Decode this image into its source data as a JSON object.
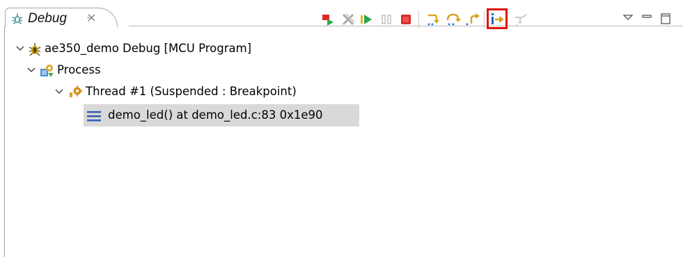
{
  "view": {
    "tab_title": "Debug",
    "tab_icon": "debug-bug-icon",
    "close_icon": "close-icon"
  },
  "toolbar": {
    "buttons": [
      {
        "name": "skip-all-breakpoints-button",
        "icon": "skip-breakpoints-icon"
      },
      {
        "name": "remove-terminated-button",
        "icon": "remove-all-terminated-icon"
      },
      {
        "name": "resume-button",
        "icon": "resume-icon"
      },
      {
        "name": "suspend-button",
        "icon": "suspend-icon"
      },
      {
        "name": "terminate-button",
        "icon": "terminate-icon"
      },
      {
        "name": "step-into-button",
        "icon": "step-into-icon"
      },
      {
        "name": "step-over-button",
        "icon": "step-over-icon"
      },
      {
        "name": "step-return-button",
        "icon": "step-return-icon"
      },
      {
        "name": "instruction-stepping-mode-button",
        "icon": "instruction-stepping-icon",
        "highlighted": true
      },
      {
        "name": "use-step-filters-button",
        "icon": "step-filters-icon"
      },
      {
        "name": "view-menu-button",
        "icon": "view-menu-icon"
      },
      {
        "name": "minimize-button",
        "icon": "minimize-icon"
      },
      {
        "name": "maximize-button",
        "icon": "maximize-icon"
      }
    ],
    "highlight_color": "#e01010"
  },
  "tree": {
    "launch": {
      "label": "ae350_demo Debug [MCU Program]",
      "icon": "debug-launch-bug-icon"
    },
    "process": {
      "label": "Process",
      "icon": "process-icon"
    },
    "thread": {
      "label": "Thread #1 (Suspended : Breakpoint)",
      "icon": "thread-suspended-icon"
    },
    "frame": {
      "label": "demo_led() at demo_led.c:83 0x1e90",
      "icon": "stack-frame-icon",
      "selected": true
    }
  },
  "colors": {
    "selection_bg": "#d9d9d9",
    "accent_red": "#e01010"
  }
}
